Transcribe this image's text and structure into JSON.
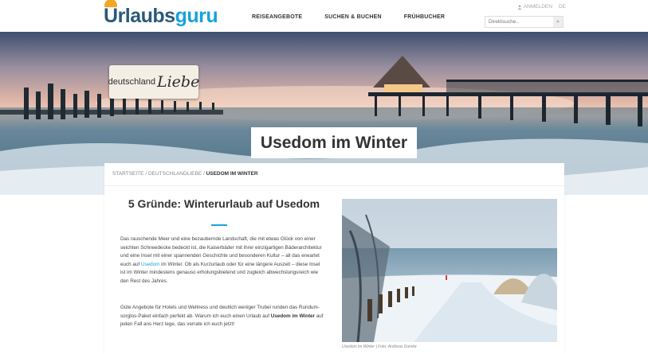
{
  "brand": {
    "logo_u": "U",
    "logo_rlaubs": "rlaubs",
    "logo_guru": "guru"
  },
  "nav": [
    "REISEANGEBOTE",
    "SUCHEN & BUCHEN",
    "FRÜHBUCHER"
  ],
  "topbar": {
    "login": "ANMELDEN",
    "lang": "DE"
  },
  "search": {
    "placeholder": "Direktsuche..",
    "button": "»"
  },
  "hero": {
    "badge_text": "deutschland",
    "badge_script": "Liebe",
    "title": "Usedom im Winter"
  },
  "breadcrumb": {
    "home": "STARTSEITE",
    "section": "DEUTSCHLANDLIEBE",
    "current": "USEDOM IM WINTER",
    "sep": "/"
  },
  "article": {
    "heading": "5 Gründe: Winterurlaub auf Usedom",
    "p1_a": "Das rauschende Meer und eine bezaubernde Landschaft, die mit etwas Glück von einer seichten Schneedecke bedeckt ist, die Kaiserbäder mit ihrer einzigartigen Bäderarchitektur und eine Insel mit einer spannenden Geschichte und besonderen Kultur – all das erwartet euch auf ",
    "p1_link": "Usedom",
    "p1_b": " im Winter. Ob als Kurzurlaub oder für eine längere Auszeit – diese Insel ist im Winter mindestens genauso erholungsbietend und zugleich abwechslungsreich wie den Rest des Jahres.",
    "p2_a": "Güte Angebote für Hotels und Wellness und deutlich weniger Trubel runden das Rundum-sorglos-Paket einfach perfekt ab. Warum ich euch einen Urlaub auf ",
    "p2_bold": "Usedom im Winter",
    "p2_b": " auf jeden Fall ans Herz lege, das verrate ich euch jetzt!",
    "caption": "Usedom im Winter | Foto: Andreas Dumke"
  },
  "colors": {
    "accent": "#18a3d9",
    "logo_dark": "#2b5a7a",
    "logo_sun": "#f5a623"
  }
}
